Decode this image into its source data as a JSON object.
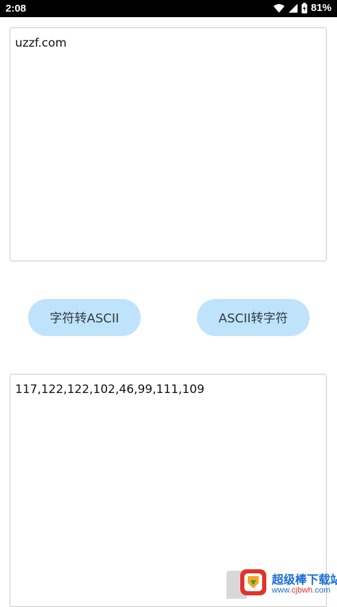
{
  "status_bar": {
    "time": "2:08",
    "battery": "81%"
  },
  "input": {
    "text": "uzzf.com"
  },
  "buttons": {
    "to_ascii": "字符转ASCII",
    "to_char": "ASCII转字符"
  },
  "output": {
    "text": "117,122,122,102,46,99,111,109"
  },
  "watermark": {
    "title": "超级棒下载站",
    "url_prefix": "www.",
    "url_highlight": "cjbwh",
    "url_suffix": ".com"
  },
  "colors": {
    "button_bg": "#bfe3fb",
    "status_bg": "#000000",
    "watermark_blue": "#1d6fd8",
    "watermark_red": "#e0332a"
  }
}
